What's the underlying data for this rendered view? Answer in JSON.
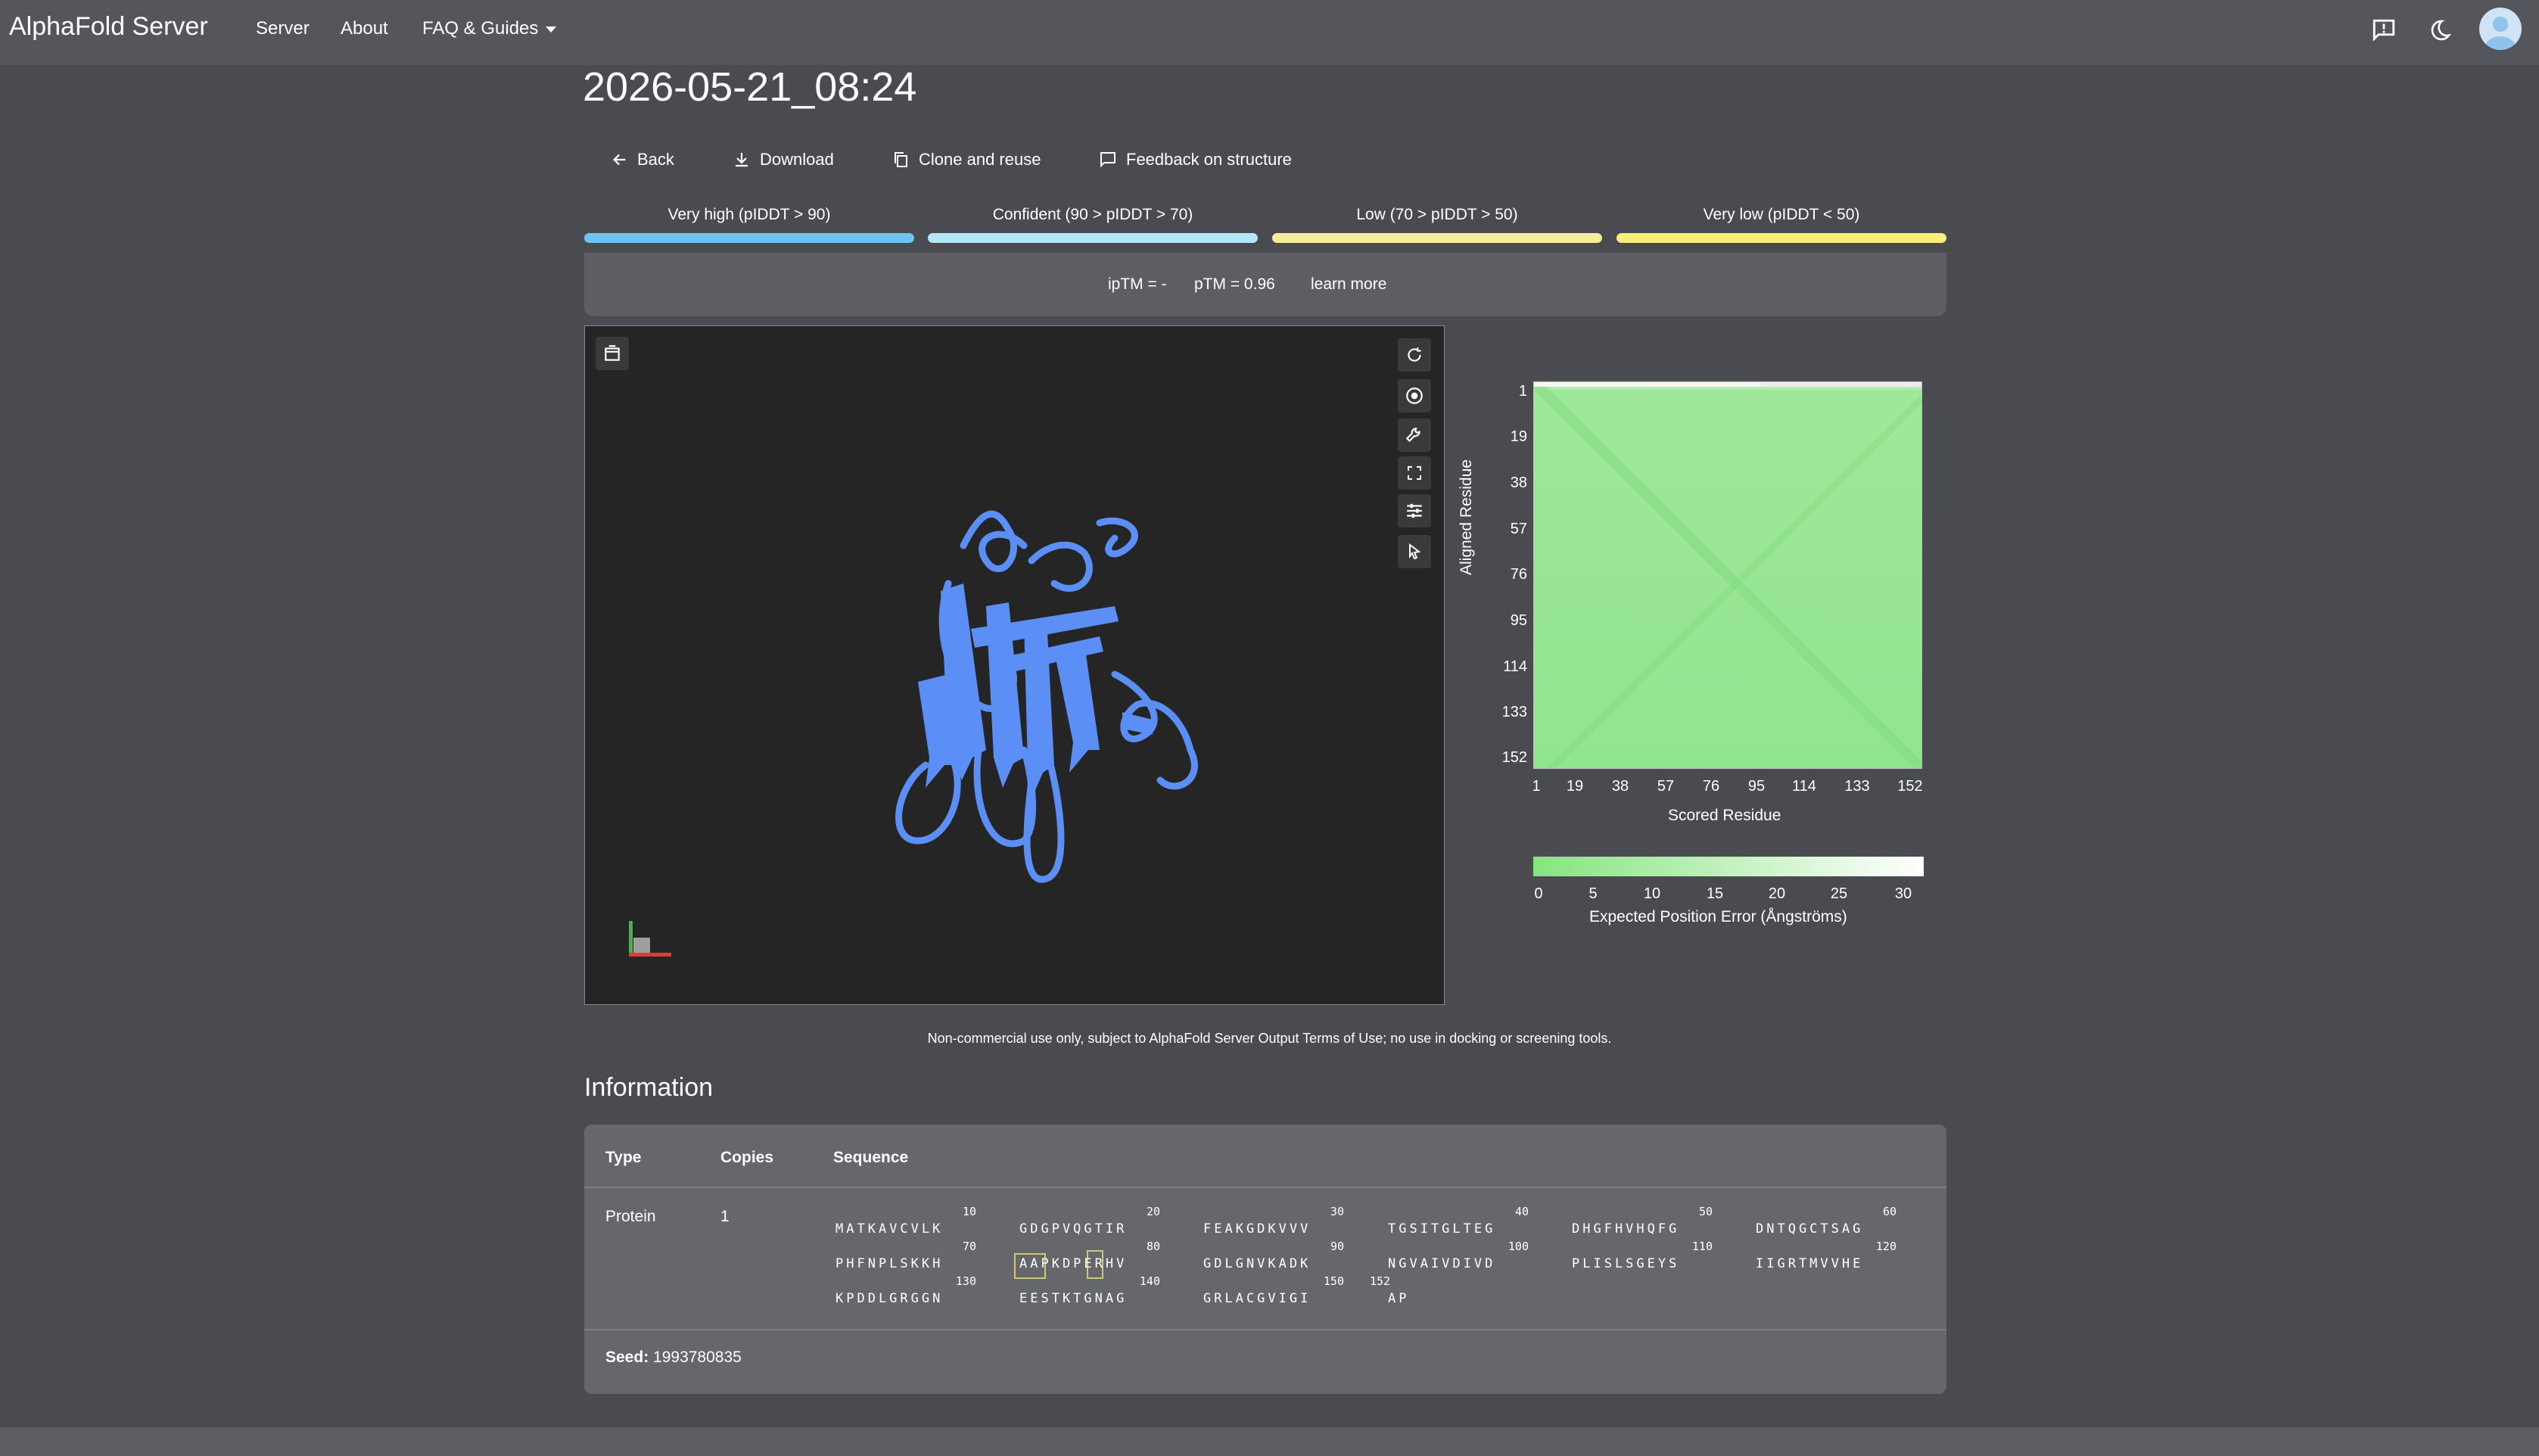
{
  "app": {
    "brand": "AlphaFold Server"
  },
  "nav": {
    "server": "Server",
    "about": "About",
    "faq": "FAQ & Guides"
  },
  "job": {
    "title": "2026-05-21_08:24"
  },
  "actions": {
    "back": "Back",
    "download": "Download",
    "clone": "Clone and reuse",
    "feedback": "Feedback on structure"
  },
  "plddt_legend": [
    {
      "label": "Very high (pIDDT > 90)",
      "color": "#6fc3f2"
    },
    {
      "label": "Confident (90 > pIDDT > 70)",
      "color": "#b4e6f7"
    },
    {
      "label": "Low (70 > pIDDT > 50)",
      "color": "#f6ec9b"
    },
    {
      "label": "Very low (pIDDT < 50)",
      "color": "#f7ef7a"
    }
  ],
  "scores": {
    "iptm": "ipTM = -",
    "ptm": "pTM = 0.96",
    "learn_more": "learn more"
  },
  "viewer": {
    "icons": [
      "spin-icon",
      "camera-icon",
      "wrench-icon",
      "fullscreen-icon",
      "settings-icon",
      "cursor-icon"
    ],
    "structure_color": "#5b8ff5"
  },
  "pae": {
    "y_ticks": [
      "1",
      "19",
      "38",
      "57",
      "76",
      "95",
      "114",
      "133",
      "152"
    ],
    "x_ticks": [
      "1",
      "19",
      "38",
      "57",
      "76",
      "95",
      "114",
      "133",
      "152"
    ],
    "ylabel": "Aligned Residue",
    "xlabel": "Scored Residue",
    "colorbar_ticks": [
      "0",
      "5",
      "10",
      "15",
      "20",
      "25",
      "30"
    ],
    "colorbar_label": "Expected Position Error (Ångströms)"
  },
  "disclaimer": "Non-commercial use only, subject to AlphaFold Server Output Terms of Use; no use in docking or screening tools.",
  "info": {
    "heading": "Information",
    "headers": {
      "type": "Type",
      "copies": "Copies",
      "sequence": "Sequence"
    },
    "row": {
      "type": "Protein",
      "copies": "1"
    },
    "seq_rows": [
      {
        "numbers": [
          "10",
          "20",
          "30",
          "40",
          "50",
          "60"
        ],
        "blocks": [
          "MATKAVCVLK",
          "GDGPVQGTIR",
          "FEAKGDKVVV",
          "TGSITGLTEG",
          "DHGFHVHQFG",
          "DNTQGCTSAG"
        ]
      },
      {
        "numbers": [
          "70",
          "80",
          "90",
          "100",
          "110",
          "120"
        ],
        "blocks": [
          "PHFNPLSKKH",
          "AAPKDPERHV",
          "GDLGNVKADK",
          "NGVAIVDIVD",
          "PLISLSGEYS",
          "IIGRTMVVHE"
        ]
      },
      {
        "numbers": [
          "130",
          "140",
          "150",
          "152",
          "",
          ""
        ],
        "blocks": [
          "KPDDLGRGGN",
          "EESTKTGNAG",
          "GRLACGVIGI",
          "AP",
          "",
          ""
        ]
      }
    ],
    "seed_label": "Seed:",
    "seed_value": "1993780835"
  }
}
